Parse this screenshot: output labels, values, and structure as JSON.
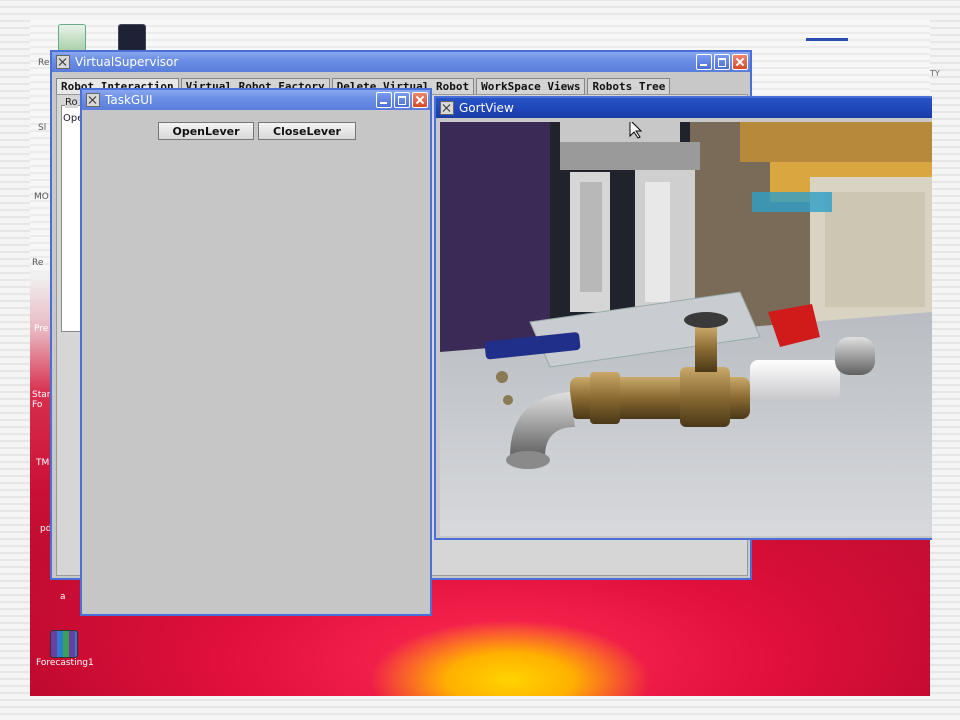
{
  "desktop": {
    "icons": [
      {
        "label": "Re"
      },
      {
        "label": "Forecasting1"
      }
    ],
    "side_labels": [
      "Re",
      "Sl",
      "MO",
      "Re",
      "Pre",
      "Star Fo",
      "TM",
      "pd",
      "a"
    ],
    "corner_text": "TY"
  },
  "windows": {
    "virtual_supervisor": {
      "title": "VirtualSupervisor",
      "tabs": [
        "Robot Interaction",
        "Virtual Robot Factory",
        "Delete Virtual Robot",
        "WorkSpace Views",
        "Robots Tree"
      ],
      "group_label": "Ro",
      "op_label": "Ope"
    },
    "task_gui": {
      "title": "TaskGUI",
      "buttons": {
        "open": "OpenLever",
        "close": "CloseLever"
      }
    },
    "gort_view": {
      "title": "GortView"
    }
  },
  "colors": {
    "title_active": "#2854c8",
    "title_inactive": "#7b9ae6",
    "valve_handle": "#d11b1b"
  }
}
